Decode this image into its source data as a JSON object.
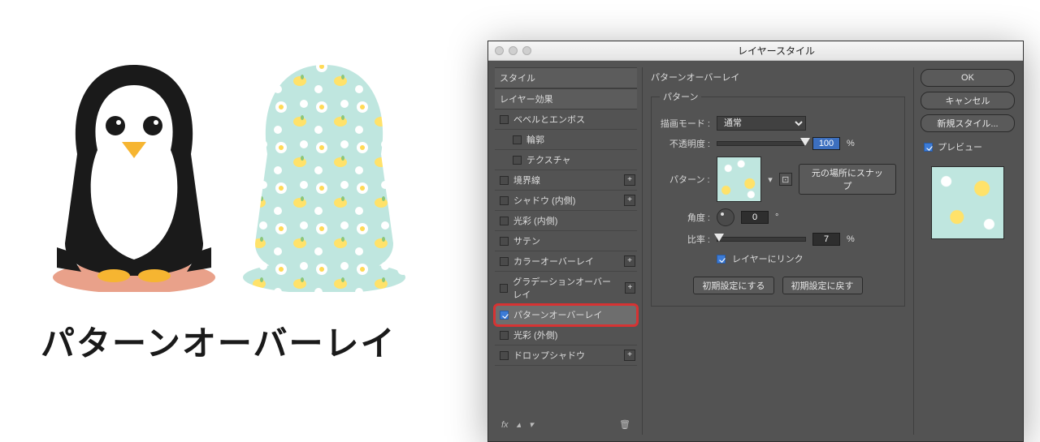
{
  "caption": "パターンオーバーレイ",
  "dialog": {
    "title": "レイヤースタイル",
    "styles_header": "スタイル",
    "effects_header": "レイヤー効果",
    "items": [
      {
        "label": "ベベルとエンボス",
        "checked": false,
        "sub": false,
        "plus": false
      },
      {
        "label": "輪郭",
        "checked": false,
        "sub": true,
        "plus": false
      },
      {
        "label": "テクスチャ",
        "checked": false,
        "sub": true,
        "plus": false
      },
      {
        "label": "境界線",
        "checked": false,
        "sub": false,
        "plus": true
      },
      {
        "label": "シャドウ (内側)",
        "checked": false,
        "sub": false,
        "plus": true
      },
      {
        "label": "光彩 (内側)",
        "checked": false,
        "sub": false,
        "plus": false
      },
      {
        "label": "サテン",
        "checked": false,
        "sub": false,
        "plus": false
      },
      {
        "label": "カラーオーバーレイ",
        "checked": false,
        "sub": false,
        "plus": true
      },
      {
        "label": "グラデーションオーバーレイ",
        "checked": false,
        "sub": false,
        "plus": true
      },
      {
        "label": "パターンオーバーレイ",
        "checked": true,
        "sub": false,
        "plus": false,
        "selected": true
      },
      {
        "label": "光彩 (外側)",
        "checked": false,
        "sub": false,
        "plus": false
      },
      {
        "label": "ドロップシャドウ",
        "checked": false,
        "sub": false,
        "plus": true
      }
    ],
    "footer_fx": "fx",
    "section_title": "パターンオーバーレイ",
    "group_title": "パターン",
    "labels": {
      "blend_mode": "描画モード :",
      "opacity": "不透明度 :",
      "pattern": "パターン :",
      "snap": "元の場所にスナップ",
      "angle": "角度 :",
      "scale": "比率 :",
      "link": "レイヤーにリンク",
      "make_default": "初期設定にする",
      "reset_default": "初期設定に戻す"
    },
    "values": {
      "blend_mode": "通常",
      "opacity": "100",
      "opacity_unit": "%",
      "angle": "0",
      "angle_unit": "°",
      "scale": "7",
      "scale_unit": "%"
    },
    "buttons": {
      "ok": "OK",
      "cancel": "キャンセル",
      "new_style": "新規スタイル...",
      "preview": "プレビュー"
    }
  }
}
